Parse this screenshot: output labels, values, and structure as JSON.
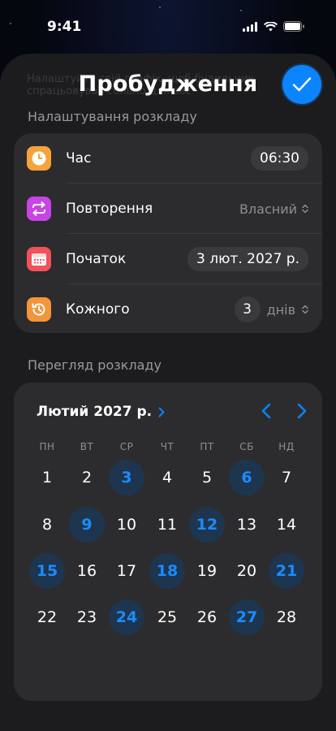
{
  "status": {
    "time": "9:41"
  },
  "sheet": {
    "title": "Пробудження",
    "ghost_text": "Налаштуйте свій графік, щоб будильник спрацьовував сольно для вас",
    "schedule_header": "Налаштування розкладу",
    "preview_header": "Перегляд розкладу"
  },
  "settings": {
    "time": {
      "label": "Час",
      "value": "06:30",
      "icon": "clock-icon"
    },
    "repeat": {
      "label": "Повторення",
      "value": "Власний",
      "icon": "repeat-icon"
    },
    "start": {
      "label": "Початок",
      "value": "3 лют. 2027 р.",
      "icon": "calendar-icon"
    },
    "every": {
      "label": "Кожного",
      "value": "3",
      "unit": "днів",
      "icon": "history-icon"
    }
  },
  "calendar": {
    "month": "Лютий 2027 р.",
    "weekdays": [
      "ПН",
      "ВТ",
      "СР",
      "ЧТ",
      "ПТ",
      "СБ",
      "НД"
    ],
    "weeks": [
      [
        "1",
        "2",
        "3",
        "4",
        "5",
        "6",
        "7"
      ],
      [
        "8",
        "9",
        "10",
        "11",
        "12",
        "13",
        "14"
      ],
      [
        "15",
        "16",
        "17",
        "18",
        "19",
        "20",
        "21"
      ],
      [
        "22",
        "23",
        "24",
        "25",
        "26",
        "27",
        "28"
      ]
    ],
    "selected": [
      "3",
      "6",
      "9",
      "12",
      "15",
      "18",
      "21",
      "24",
      "27"
    ]
  },
  "colors": {
    "accent": "#0a84ff",
    "time_icon": "#f5a33b",
    "repeat_icon": "#c844e6",
    "start_icon": "#f0515a",
    "every_icon": "#f3953a"
  }
}
